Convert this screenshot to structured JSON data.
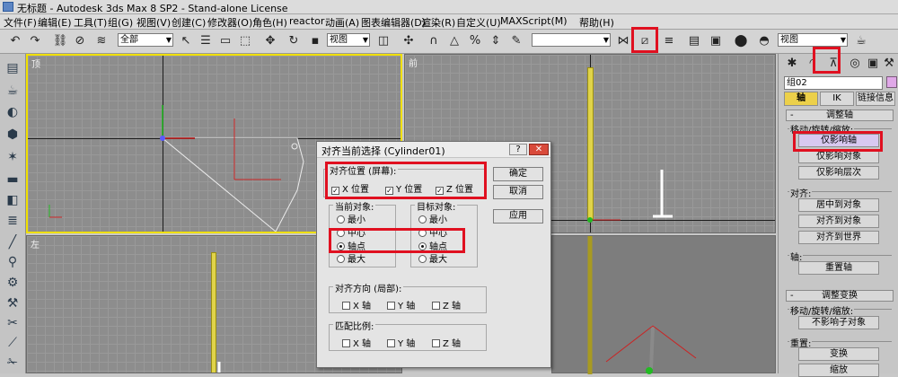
{
  "title": "无标题 - Autodesk 3ds Max 8 SP2 - Stand-alone License",
  "menu": [
    "文件(F)",
    "编辑(E)",
    "工具(T)",
    "组(G)",
    "视图(V)",
    "创建(C)",
    "修改器(O)",
    "角色(H)",
    "reactor",
    "动画(A)",
    "图表编辑器(D)",
    "渲染(R)",
    "自定义(U)",
    "MAXScript(M)",
    "帮助(H)"
  ],
  "toolbar": {
    "selection_filter": "全部",
    "coord_system": "视图",
    "named_selection": "",
    "coord_system_2": "视图"
  },
  "viewports": {
    "top_label": "顶",
    "front_label": "前",
    "left_label": "左"
  },
  "command_panel": {
    "object_name": "组02",
    "tab_pivot": "轴",
    "tab_ik": "IK",
    "tab_link": "链接信息",
    "rollout_adjust_pivot": "调整轴",
    "group_move": "移动/旋转/缩放:",
    "affect_pivot_only": "仅影响轴",
    "affect_object_only": "仅影响对象",
    "affect_hierarchy_only": "仅影响层次",
    "group_align": "对齐:",
    "center_to_object": "居中到对象",
    "align_to_object": "对齐到对象",
    "align_to_world": "对齐到世界",
    "group_pivot": "轴:",
    "reset_pivot": "重置轴",
    "rollout_adjust_transform": "调整变换",
    "group_move2": "移动/旋转/缩放:",
    "dont_affect_children": "不影响子对象",
    "group_reset": "重置:",
    "transform": "变换",
    "scale": "缩放"
  },
  "dialog": {
    "title": "对齐当前选择 (Cylinder01)",
    "help": "?",
    "close": "✕",
    "align_position_label": "对齐位置 (屏幕):",
    "x_pos": "X 位置",
    "y_pos": "Y 位置",
    "z_pos": "Z 位置",
    "current_object_label": "当前对象:",
    "target_object_label": "目标对象:",
    "opt_min": "最小",
    "opt_center": "中心",
    "opt_pivot": "轴点",
    "opt_max": "最大",
    "orientation_label": "对齐方向 (局部):",
    "x_axis": "X 轴",
    "y_axis": "Y 轴",
    "z_axis": "Z 轴",
    "scale_label": "匹配比例:",
    "ok": "确定",
    "cancel": "取消",
    "apply": "应用"
  },
  "colors": {
    "highlight_red": "#e01020",
    "viewport_active_border": "#f0e000",
    "pole_yellow": "#e0d34a",
    "panel_active": "#d8c8f0"
  }
}
